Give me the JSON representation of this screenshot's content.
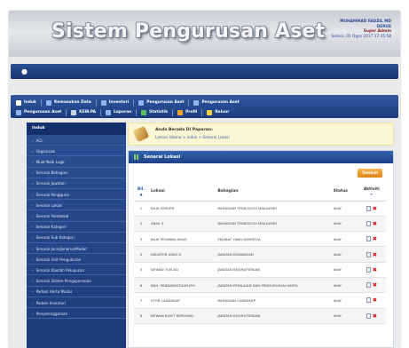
{
  "header": {
    "title": "Sistem Pengurusan Aset",
    "user_name": "MUHAMMAD FADZIL MD",
    "user_name_2": "DERUS",
    "user_role": "Super Admin",
    "session": "Selasa, 01 Ogos 2017 17:35:58"
  },
  "menu": {
    "row1": [
      "Induk",
      "Kemasukan Data",
      "Inventori",
      "Pengurusan Aset",
      "Pengurusan Aset"
    ],
    "row2": [
      "Pengurusan Aset",
      "KEW.PA",
      "Laporan",
      "Statistik",
      "Profil",
      "Keluar"
    ]
  },
  "sidebar": {
    "title": "Induk",
    "items": [
      "ACL",
      "Organisasi",
      "Muat-Naik Logo",
      "Senarai Bahagian",
      "Senarai Jawatan",
      "Senarai Pengguna",
      "Senarai Lokasi",
      "Senarai Pembekal",
      "Senarai Kategori",
      "Senarai Sub Kategori",
      "Senarai Jenis/Jenama/Model",
      "Senarai Unit Pengukuran",
      "Senarai Kaedah Pelupusan",
      "Senarai Sistem Pengoperasian",
      "Padam Harta Modal",
      "Padam Inventori",
      "Penyelenggaraan"
    ]
  },
  "breadcrumb": {
    "title": "Anda Berada Di Paparan:",
    "path": "Laman Utama > Induk > Senarai Lokasi"
  },
  "panel": {
    "title": "Senarai Lokasi",
    "add_label": "Tambah"
  },
  "table": {
    "headers": {
      "bil": "Bil.",
      "lokasi": "Lokasi",
      "bahagian": "Bahagian",
      "status": "Status",
      "aktiviti": "Aktiviti"
    },
    "rows": [
      {
        "bil": "1",
        "lokasi": "BILIK SERVER",
        "bahagian": "BAHAGIAN TEKNOLOGI MAKLUMAT",
        "status": "Aktif"
      },
      {
        "bil": "2",
        "lokasi": "ARAS 3",
        "bahagian": "BAHAGIAN TEKNOLOGI MAKLUMAT",
        "status": "Aktif"
      },
      {
        "bil": "3",
        "lokasi": "BILIK PEGAWAI KHAS",
        "bahagian": "PEJABAT YANG DIPERTUA",
        "status": "Aktif"
      },
      {
        "bil": "4",
        "lokasi": "KAUNTER ARAS G",
        "bahagian": "JABATAN KEWANGAN",
        "status": "Aktif"
      },
      {
        "bil": "5",
        "lokasi": "DEWAN TUN ALI",
        "bahagian": "JABATAN KEJURUTERAAN",
        "status": "Aktif"
      },
      {
        "bil": "6",
        "lokasi": "BAH. PENDAKASTAAN JPH",
        "bahagian": "JABATAN PENILAIAN DAN PENGURUSAN HARTA",
        "status": "Aktif"
      },
      {
        "bil": "7",
        "lokasi": "STOR LANDSKAP",
        "bahagian": "BAHAGIAN LANDSKAP",
        "status": "Aktif"
      },
      {
        "bil": "8",
        "lokasi": "DEWAN BUKIT BERUANG",
        "bahagian": "JABATAN KEJURUTERAAN",
        "status": "Aktif"
      }
    ]
  }
}
